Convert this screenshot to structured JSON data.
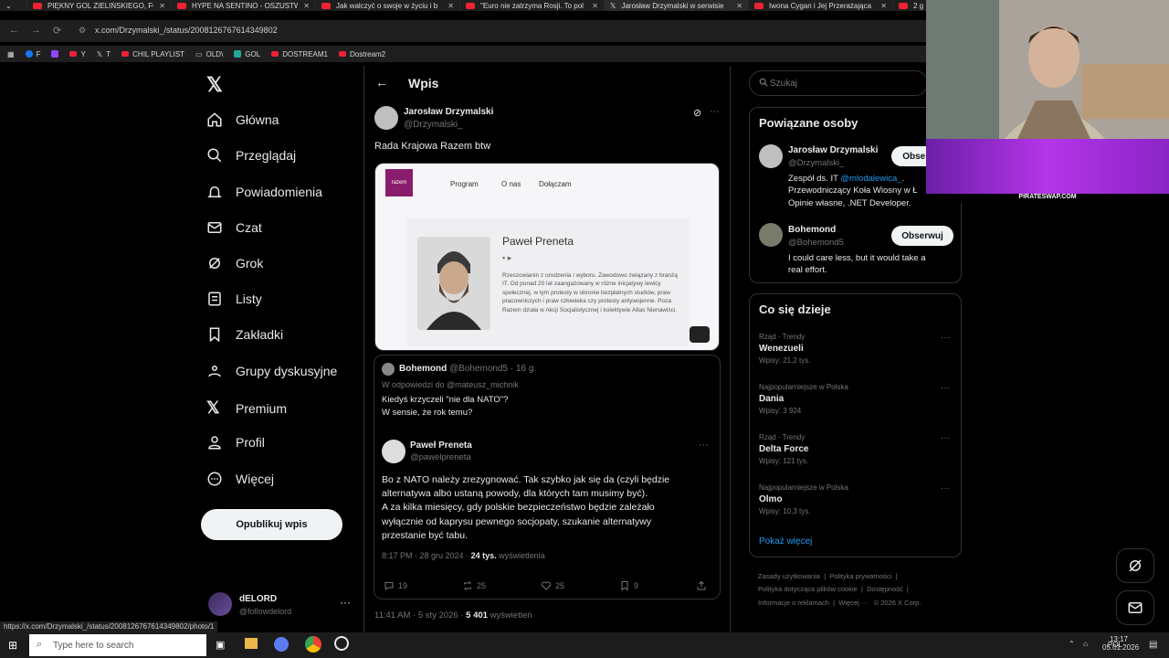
{
  "browser": {
    "tabs": [
      {
        "title": "PIĘKNY GOL ZIELIŃSKIEGO, FO",
        "kind": "yt"
      },
      {
        "title": "HYPE NA SENTINO - OSZUSTW",
        "kind": "yt"
      },
      {
        "title": "Jak walczyć o swoje w życiu i b",
        "kind": "yt"
      },
      {
        "title": "\"Euro nie zatrzyma Rosji. To pol",
        "kind": "yt"
      },
      {
        "title": "Jarosław Drzymalski w serwisie",
        "kind": "x",
        "active": true
      },
      {
        "title": "Iwona Cygan i Jej Przerażająca",
        "kind": "yt"
      },
      {
        "title": "2 g",
        "kind": "yt"
      }
    ],
    "url": "x.com/Drzymalski_/status/2008126767614349802",
    "bookmarks": [
      "F",
      "Y",
      "T",
      "CHIL PLAYLIST",
      "OLD\\",
      "GOL",
      "DOSTREAM1",
      "Dostream2"
    ],
    "status_url": "https://x.com/Drzymalski_/status/2008126767614349802/photo/1"
  },
  "nav": {
    "items": [
      "Główna",
      "Przeglądaj",
      "Powiadomienia",
      "Czat",
      "Grok",
      "Listy",
      "Zakładki",
      "Grupy dyskusyjne",
      "Premium",
      "Profil",
      "Więcej"
    ],
    "post_button": "Opublikuj wpis",
    "account_name": "dELORD",
    "account_handle": "@followdelord"
  },
  "main": {
    "header": "Wpis",
    "author_name": "Jarosław Drzymalski",
    "author_handle": "@Drzymalski_",
    "text": "Rada Krajowa Razem btw",
    "card": {
      "logo": "razem",
      "nav": [
        "Program",
        "O nas",
        "Dołączam"
      ],
      "person": "Paweł Preneta",
      "bio": "Rzeszowianin z urodzenia i wyboru. Zawodowo związany z branżą IT. Od ponad 20 lat zaangażowany w różne inicjatywy lewicy społecznej, w tym protesty w obronie bezpłatnych studiów, praw pracowniczych i praw człowieka czy protesty antywojenne. Poza Razem działa w Akcji Socjalistycznej i kolektywie Atlas Nienawiści."
    },
    "reply": {
      "name": "Bohemond",
      "handle": "@Bohemond5",
      "age": "· 16 g.",
      "in_reply_to": "W odpowiedzi do @mateusz_michnik",
      "line1": "Kiedyś krzyczeli \"nie dla NATO\"?",
      "line2": "W sensie, że rok temu?"
    },
    "quoted": {
      "name": "Paweł Preneta",
      "handle": "@pawelpreneta",
      "lines": [
        "Bo z NATO należy zrezygnować. Tak szybko jak się da (czyli będzie",
        "alternatywa albo ustaną powody, dla których tam musimy być).",
        "A za kilka miesięcy, gdy polskie bezpieczeństwo będzie zależało",
        "wyłącznie od kaprysu pewnego socjopaty, szukanie alternatywy",
        "przestanie być tabu."
      ],
      "time": "8:17 PM · 28 gru 2024 ·",
      "views": "24 tys.",
      "views_label": "wyświetlenia",
      "replies": "19",
      "reposts": "25",
      "likes": "25",
      "bookmarks": "9"
    },
    "timestamp": "11:41 AM · 5 sty 2026 ·",
    "views": "5 401",
    "views_label": "wyświetleń"
  },
  "right": {
    "search_placeholder": "Szukaj",
    "related_title": "Powiązane osoby",
    "people": [
      {
        "name": "Jarosław Drzymalski",
        "handle": "@Drzymalski_",
        "button": "Obserwuj",
        "bio1": "Zespół ds. IT ",
        "bio_link": "@mlodalewica_",
        "bio2": ". Przewodniczący Koła Wiosny w Ł",
        "bio3": "Opinie własne, .NET Developer."
      },
      {
        "name": "Bohemond",
        "handle": "@Bohemond5",
        "button": "Obserwuj",
        "bio1": "I could care less, but it would take a",
        "bio3": "real effort."
      }
    ],
    "trends_title": "Co się dzieje",
    "trends": [
      {
        "meta": "Rząd · Trendy",
        "name": "Wenezueli",
        "count": "Wpisy: 21,2 tys."
      },
      {
        "meta": "Najpopularniejsze w Polska",
        "name": "Dania",
        "count": "Wpisy: 3 924"
      },
      {
        "meta": "Rząd · Trendy",
        "name": "Delta Force",
        "count": "Wpisy: 121 tys."
      },
      {
        "meta": "Najpopularniejsze w Polska",
        "name": "Olmo",
        "count": "Wpisy: 10,3 tys."
      }
    ],
    "show_more": "Pokaż więcej",
    "footer": [
      "Zasady użytkowania",
      "Polityka prywatności",
      "Polityka dotycząca plików cookie",
      "Dostępność",
      "Informacje o reklamach",
      "Więcej ···",
      "© 2026 X Corp."
    ]
  },
  "overlay": {
    "brand": "PIRATESWAP.COM"
  },
  "taskbar": {
    "search": "Type here to search",
    "lang": "POL",
    "time": "13:17",
    "date": "05.01.2026"
  }
}
